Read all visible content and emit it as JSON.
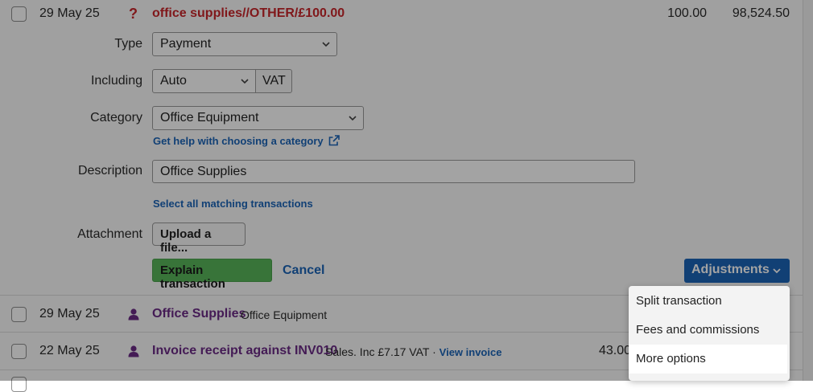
{
  "transaction": {
    "date": "29 May 25",
    "status_mark": "?",
    "title": "office supplies//OTHER/£100.00",
    "amount": "100.00",
    "balance": "98,524.50"
  },
  "form": {
    "type_label": "Type",
    "type_value": "Payment",
    "including_label": "Including",
    "including_value": "Auto",
    "vat_label": "VAT",
    "category_label": "Category",
    "category_value": "Office Equipment",
    "category_help_link": "Get help with choosing a category",
    "description_label": "Description",
    "description_value": "Office Supplies",
    "select_matching_link": "Select all matching transactions",
    "attachment_label": "Attachment",
    "upload_button": "Upload a file...",
    "explain_button": "Explain transaction",
    "cancel_link": "Cancel",
    "adjustments_button": "Adjustments"
  },
  "rows": [
    {
      "date": "29 May 25",
      "title": "Office Supplies",
      "detail": "Office Equipment"
    },
    {
      "date": "22 May 25",
      "title": "Invoice receipt against INV010",
      "detail": "Sales. Inc £7.17 VAT · ",
      "link": "View invoice",
      "amount": "43.00"
    }
  ],
  "adjustments_menu": {
    "items": [
      "Split transaction",
      "Fees and commissions",
      "More options"
    ],
    "highlighted_index": 2
  },
  "icons": {
    "chevron": "chevron-down-icon",
    "external": "external-link-icon",
    "person": "person-icon"
  },
  "colors": {
    "unexplained_red": "#c9262b",
    "link_blue": "#1b64b8",
    "explain_green": "#58b65a",
    "explained_purple": "#6b2b86"
  }
}
